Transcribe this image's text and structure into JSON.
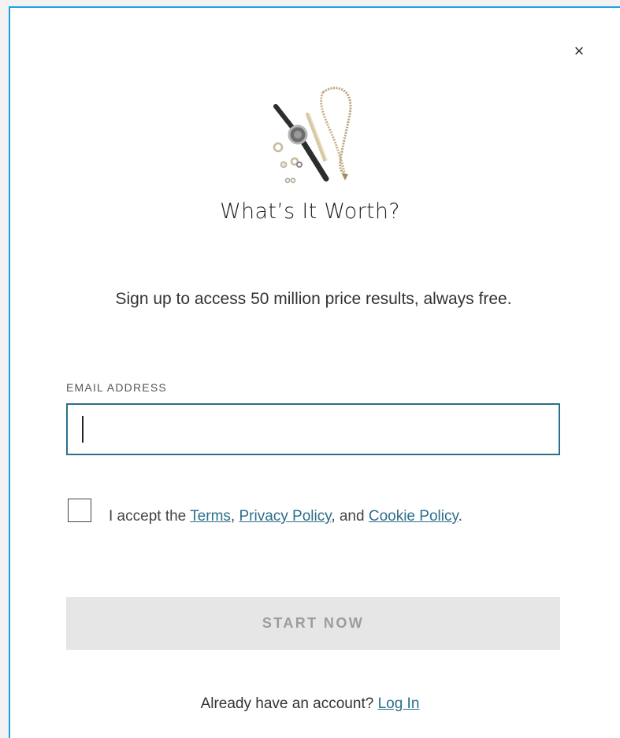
{
  "modal": {
    "close_glyph": "×",
    "title": "What’s It Worth?",
    "subtitle": "Sign up to access 50 million price results, always free.",
    "illustration_icon": "jewelry-watch-necklace-icon"
  },
  "form": {
    "email_label": "EMAIL ADDRESS",
    "email_value": "",
    "email_placeholder": "",
    "consent": {
      "prefix": "I accept the ",
      "terms": "Terms",
      "sep1": ", ",
      "privacy": "Privacy Policy",
      "sep2": ", and ",
      "cookie": "Cookie Policy",
      "suffix": "."
    },
    "submit_label": "START NOW"
  },
  "footer": {
    "prompt": "Already have an account? ",
    "login_label": "Log In"
  },
  "colors": {
    "modal_border": "#1da1e6",
    "link": "#2c6f8b",
    "button_disabled_bg": "#e6e6e6",
    "button_disabled_text": "#9c9c9c"
  }
}
